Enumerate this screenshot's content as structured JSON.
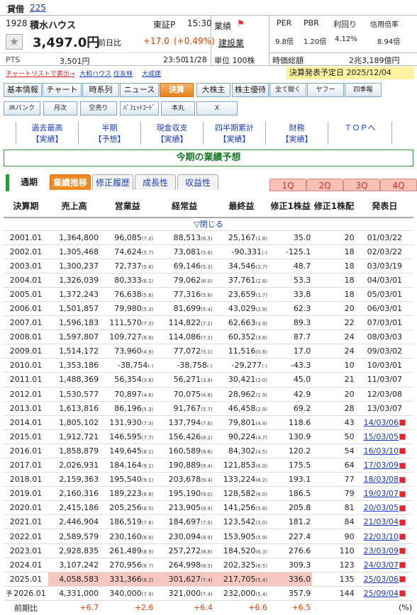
{
  "header": {
    "label": "貸借",
    "link": "225"
  },
  "stock": {
    "code": "1928",
    "name": "積水ハウス",
    "market": "東証P",
    "time": "15:30",
    "price": "3,497.0円",
    "change_label": "前日比",
    "change": "+17.0",
    "change_pct": "(+0.49%)",
    "pts_label": "PTS",
    "pts_price": "3,501円",
    "pts_time": "23:50",
    "pts_date": "11/28"
  },
  "sector": {
    "label": "業績",
    "industry": "建設業",
    "unit": "単位 100株"
  },
  "metrics": {
    "per_label": "PER",
    "pbr_label": "PBR",
    "yield_label": "利回り",
    "margin_label": "信用倍率",
    "per": "9.8倍",
    "pbr": "1.20倍",
    "yield": "4.12%",
    "margin": "8.94倍",
    "mcap_label": "時価総額",
    "mcap": "2兆3,189億円"
  },
  "chart_links": {
    "label": "チャートリストで表示→",
    "items": [
      "大和ハウス",
      "住友林",
      "大成建"
    ]
  },
  "earnings_date": "決算発表予定日 2025/12/04",
  "tabs1": [
    "基本情報",
    "チャート",
    "時系列",
    "ニュース",
    "決算",
    "大株主",
    "株主優待",
    "全て開く",
    "ヤフー",
    "四季報"
  ],
  "tabs2": [
    "IRバンク",
    "月次",
    "空売り",
    "ﾊﾞﾌｪｯﾄｺｰﾄﾞ",
    "本丸",
    "X"
  ],
  "links": [
    {
      "a": "過去最高",
      "b": "【実績】"
    },
    {
      "a": "半期",
      "b": "【予想】"
    },
    {
      "a": "現金収支",
      "b": "【実績】"
    },
    {
      "a": "四半期累計",
      "b": "【実績】"
    },
    {
      "a": "財務",
      "b": "【実績】"
    },
    {
      "a": "ＴＯＰへ",
      "b": ""
    }
  ],
  "section_title": "今期の業績予想",
  "subtabs": [
    "通期",
    "業績推移",
    "修正履歴",
    "成長性",
    "収益性"
  ],
  "quarters": [
    "1Q",
    "2Q",
    "3Q",
    "4Q"
  ],
  "table": {
    "headers": [
      "決算期",
      "売上高",
      "営業益",
      "経常益",
      "最終益",
      "修正1株益",
      "修正1株配",
      "発表日"
    ],
    "toggle": "▽閉じる",
    "rows": [
      [
        "2001.01",
        "1,364,800",
        "96,085",
        "7.0",
        "88,513",
        "6.5",
        "25,167",
        "1.8",
        "35.0",
        "20",
        "01/03/22"
      ],
      [
        "2002.01",
        "1,305,468",
        "74,624",
        "5.7",
        "73,081",
        "5.6",
        "-90,331",
        "-",
        "-125.1",
        "18",
        "02/03/22"
      ],
      [
        "2003.01",
        "1,300,237",
        "72,737",
        "5.6",
        "69,146",
        "5.3",
        "34,546",
        "2.7",
        "48.7",
        "18",
        "03/03/19"
      ],
      [
        "2004.01",
        "1,326,039",
        "80,333",
        "6.1",
        "79,062",
        "6.0",
        "37,761",
        "2.8",
        "53.3",
        "18",
        "04/03/01"
      ],
      [
        "2005.01",
        "1,372,243",
        "76,638",
        "5.6",
        "77,316",
        "5.6",
        "23,659",
        "1.7",
        "33.8",
        "18",
        "05/03/01"
      ],
      [
        "2006.01",
        "1,501,857",
        "79,980",
        "5.3",
        "81,699",
        "5.4",
        "43,029",
        "2.9",
        "62.3",
        "20",
        "06/03/01"
      ],
      [
        "2007.01",
        "1,596,183",
        "111,570",
        "7.0",
        "114,822",
        "7.2",
        "62,663",
        "3.9",
        "89.3",
        "22",
        "07/03/01"
      ],
      [
        "2008.01",
        "1,597,807",
        "109,727",
        "6.9",
        "114,086",
        "7.1",
        "60,352",
        "3.8",
        "87.7",
        "24",
        "08/03/03"
      ],
      [
        "2009.01",
        "1,514,172",
        "73,960",
        "4.9",
        "77,072",
        "5.1",
        "11,516",
        "0.8",
        "17.0",
        "24",
        "09/03/02"
      ],
      [
        "2010.01",
        "1,353,186",
        "-38,754",
        "-",
        "-38,758",
        "-",
        "-29,277",
        "-",
        "-43.3",
        "10",
        "10/03/01"
      ],
      [
        "2011.01",
        "1,488,369",
        "56,354",
        "3.8",
        "56,271",
        "3.8",
        "30,421",
        "2.0",
        "45.0",
        "21",
        "11/03/07"
      ],
      [
        "2012.01",
        "1,530,577",
        "70,897",
        "4.6",
        "70,075",
        "4.6",
        "28,962",
        "1.9",
        "42.9",
        "20",
        "12/03/08"
      ],
      [
        "2013.01",
        "1,613,816",
        "86,196",
        "5.3",
        "91,767",
        "5.7",
        "46,458",
        "2.9",
        "69.2",
        "28",
        "13/03/07"
      ],
      [
        "2014.01",
        "1,805,102",
        "131,930",
        "7.3",
        "137,794",
        "7.6",
        "79,801",
        "4.4",
        "118.6",
        "43",
        "14/03/06"
      ],
      [
        "2015.01",
        "1,912,721",
        "146,595",
        "7.7",
        "156,426",
        "8.2",
        "90,224",
        "4.7",
        "130.9",
        "50",
        "15/03/05"
      ],
      [
        "2016.01",
        "1,858,879",
        "149,645",
        "8.1",
        "160,589",
        "8.6",
        "84,302",
        "4.5",
        "120.2",
        "54",
        "16/03/10"
      ],
      [
        "2017.01",
        "2,026,931",
        "184,164",
        "9.1",
        "190,889",
        "9.4",
        "121,853",
        "6.0",
        "175.5",
        "64",
        "17/03/09"
      ],
      [
        "2018.01",
        "2,159,363",
        "195,540",
        "9.1",
        "203,678",
        "9.4",
        "133,224",
        "6.2",
        "193.1",
        "77",
        "18/03/08"
      ],
      [
        "2019.01",
        "2,160,316",
        "189,223",
        "8.8",
        "195,190",
        "9.0",
        "128,582",
        "6.0",
        "186.5",
        "79",
        "19/03/07"
      ],
      [
        "2020.01",
        "2,415,186",
        "205,256",
        "8.5",
        "213,905",
        "8.9",
        "141,256",
        "5.8",
        "205.8",
        "81",
        "20/03/05"
      ],
      [
        "2021.01",
        "2,446,904",
        "186,519",
        "7.6",
        "184,697",
        "7.5",
        "123,542",
        "5.0",
        "181.2",
        "84",
        "21/03/04"
      ],
      [
        "2022.01",
        "2,589,579",
        "230,160",
        "8.9",
        "230,094",
        "8.9",
        "153,905",
        "5.9",
        "227.4",
        "90",
        "22/03/10"
      ],
      [
        "2023.01",
        "2,928,835",
        "261,489",
        "8.9",
        "257,272",
        "8.8",
        "184,520",
        "6.3",
        "276.6",
        "110",
        "23/03/09"
      ],
      [
        "2024.01",
        "3,107,242",
        "270,956",
        "8.7",
        "264,998",
        "8.5",
        "202,325",
        "6.5",
        "309.3",
        "123",
        "24/03/07"
      ],
      [
        "2025.01",
        "4,058,583",
        "331,366",
        "8.2",
        "301,627",
        "7.4",
        "217,705",
        "5.4",
        "336.0",
        "135",
        "25/03/06"
      ],
      [
        "2026.01",
        "4,331,000",
        "340,000",
        "7.9",
        "321,000",
        "7.4",
        "232,000",
        "5.4",
        "357.9",
        "144",
        "25/09/04"
      ]
    ],
    "forecast_mark": "予",
    "footer": [
      "前期比",
      "+6.7",
      "+2.6",
      "+6.4",
      "+6.6",
      "+6.5",
      "",
      "(%)"
    ]
  }
}
